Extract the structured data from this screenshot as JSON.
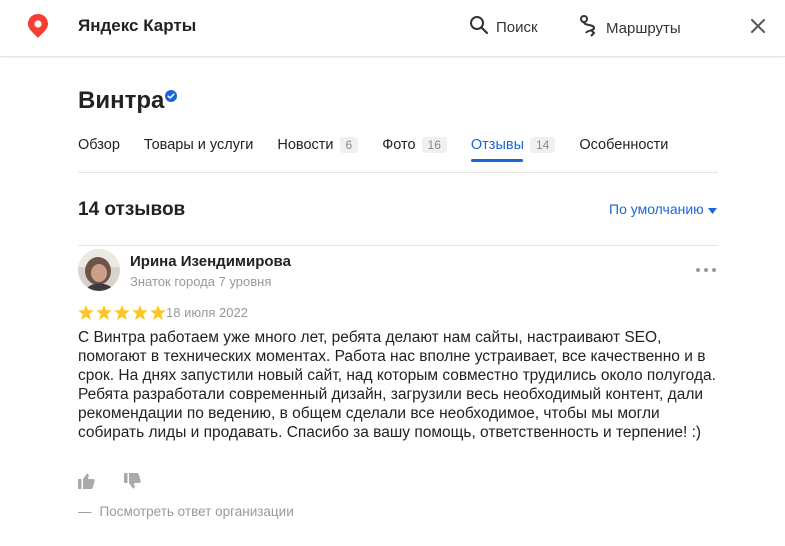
{
  "header": {
    "app_title": "Яндекс Карты",
    "search_label": "Поиск",
    "routes_label": "Маршруты"
  },
  "organization": {
    "name": "Винтра"
  },
  "tabs": [
    {
      "label": "Обзор",
      "count": ""
    },
    {
      "label": "Товары и услуги",
      "count": ""
    },
    {
      "label": "Новости",
      "count": "6"
    },
    {
      "label": "Фото",
      "count": "16"
    },
    {
      "label": "Отзывы",
      "count": "14",
      "active": true
    },
    {
      "label": "Особенности",
      "count": ""
    }
  ],
  "reviews": {
    "count_label": "14 отзывов",
    "sort_label": "По умолчанию",
    "items": [
      {
        "author": "Ирина Изендимирова",
        "author_level": "Знаток города 7 уровня",
        "rating": 5,
        "date": "18 июля 2022",
        "text": "С Винтра работаем уже много лет, ребята делают нам сайты, настраивают SEO, помогают в технических моментах. Работа нас вполне устраивает, все качественно и в срок. На днях запустили новый сайт, над которым совместно трудились около полугода. Ребята разработали современный дизайн, загрузили весь необходимый контент, дали рекомендации по ведению, в общем сделали все необходимое, чтобы мы могли собирать лиды и продавать. Спасибо за вашу помощь, ответственность и терпение! :)",
        "reply_dash": "—",
        "reply_link": "Посмотреть ответ организации"
      }
    ]
  },
  "colors": {
    "accent": "#1a66d6",
    "star": "#fcc521",
    "pin": "#f43f32",
    "verified": "#1a66d6"
  },
  "icons": {
    "logo": "map-pin-icon",
    "search": "search-icon",
    "routes": "route-icon",
    "close": "close-icon",
    "verified": "verified-badge-icon",
    "sort": "chevron-down-icon",
    "more": "more-dots-icon",
    "star": "star-icon",
    "like": "thumbs-up-icon",
    "dislike": "thumbs-down-icon"
  }
}
